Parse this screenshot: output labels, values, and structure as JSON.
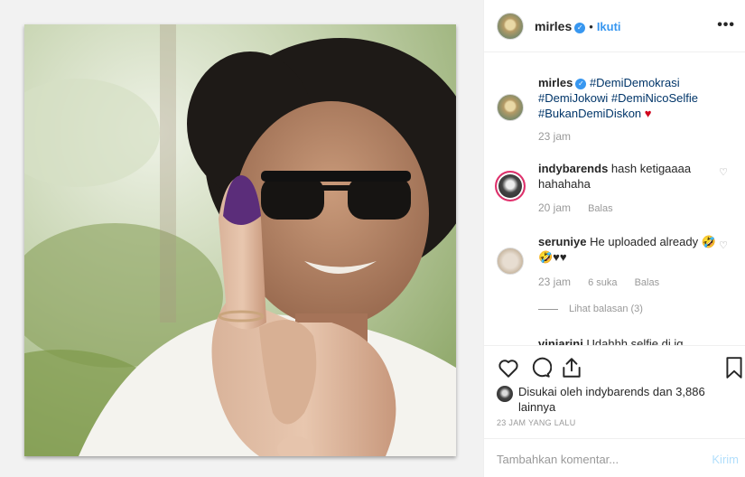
{
  "post": {
    "username": "mirles",
    "follow_label": "Ikuti",
    "separator": "•",
    "more_label": "•••"
  },
  "caption": {
    "username": "mirles",
    "text": "#DemiDemokrasi #DemiJokowi #DemiNicoSelfie #BukanDemiDiskon",
    "emoji": "♥",
    "time": "23 jam"
  },
  "comments": [
    {
      "username": "indybarends",
      "text": "hash ketigaaaa hahahaha",
      "time": "20 jam",
      "reply_label": "Balas"
    },
    {
      "username": "seruniye",
      "text": "He uploaded already 🤣🤣♥♥",
      "time": "23 jam",
      "likes": "6 suka",
      "reply_label": "Balas",
      "view_replies": "Lihat balasan (3)"
    },
    {
      "username": "viniarini",
      "text": "Udahhh selfie di ig"
    }
  ],
  "likes": {
    "text": "Disukai oleh indybarends dan 3,886 lainnya"
  },
  "timestamp": "23 JAM YANG LALU",
  "composer": {
    "placeholder": "Tambahkan komentar...",
    "send_label": "Kirim"
  },
  "colors": {
    "accent": "#3897f0",
    "heart": "#d0021b",
    "nail_polish": "#5b2d7a"
  }
}
